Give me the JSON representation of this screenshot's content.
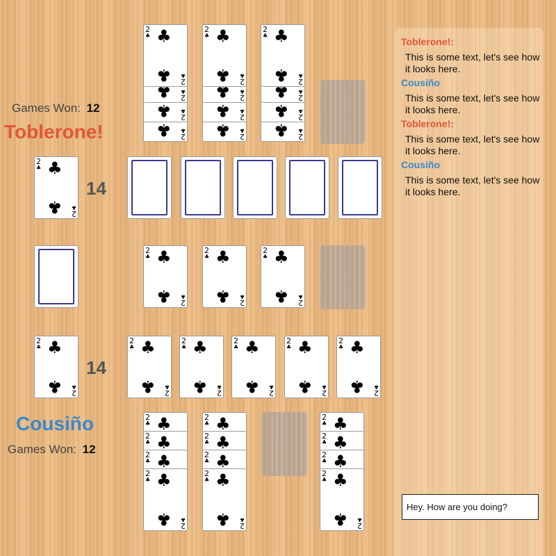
{
  "opponent": {
    "name": "Toblerone!",
    "games_won_label": "Games Won:",
    "games_won": "12",
    "pile_count": "14",
    "color": "#e0583a"
  },
  "player": {
    "name": "Cousiño",
    "games_won_label": "Games Won:",
    "games_won": "12",
    "pile_count": "14",
    "color": "#3a88cc"
  },
  "card": {
    "rank": "2",
    "suit": "♣",
    "suit_name": "clubs"
  },
  "chat": {
    "messages": [
      {
        "author": "Toblerone!:",
        "text": "This is some text, let's see how it looks here."
      },
      {
        "author": "Cousiño",
        "text": "This is some text, let's see how it looks here."
      },
      {
        "author": "Toblerone!:",
        "text": "This is some text, let's see how it looks here."
      },
      {
        "author": "Cousiño",
        "text": "This is some text, let's see how it looks here."
      }
    ],
    "input_value": "Hey. How are you doing?"
  }
}
